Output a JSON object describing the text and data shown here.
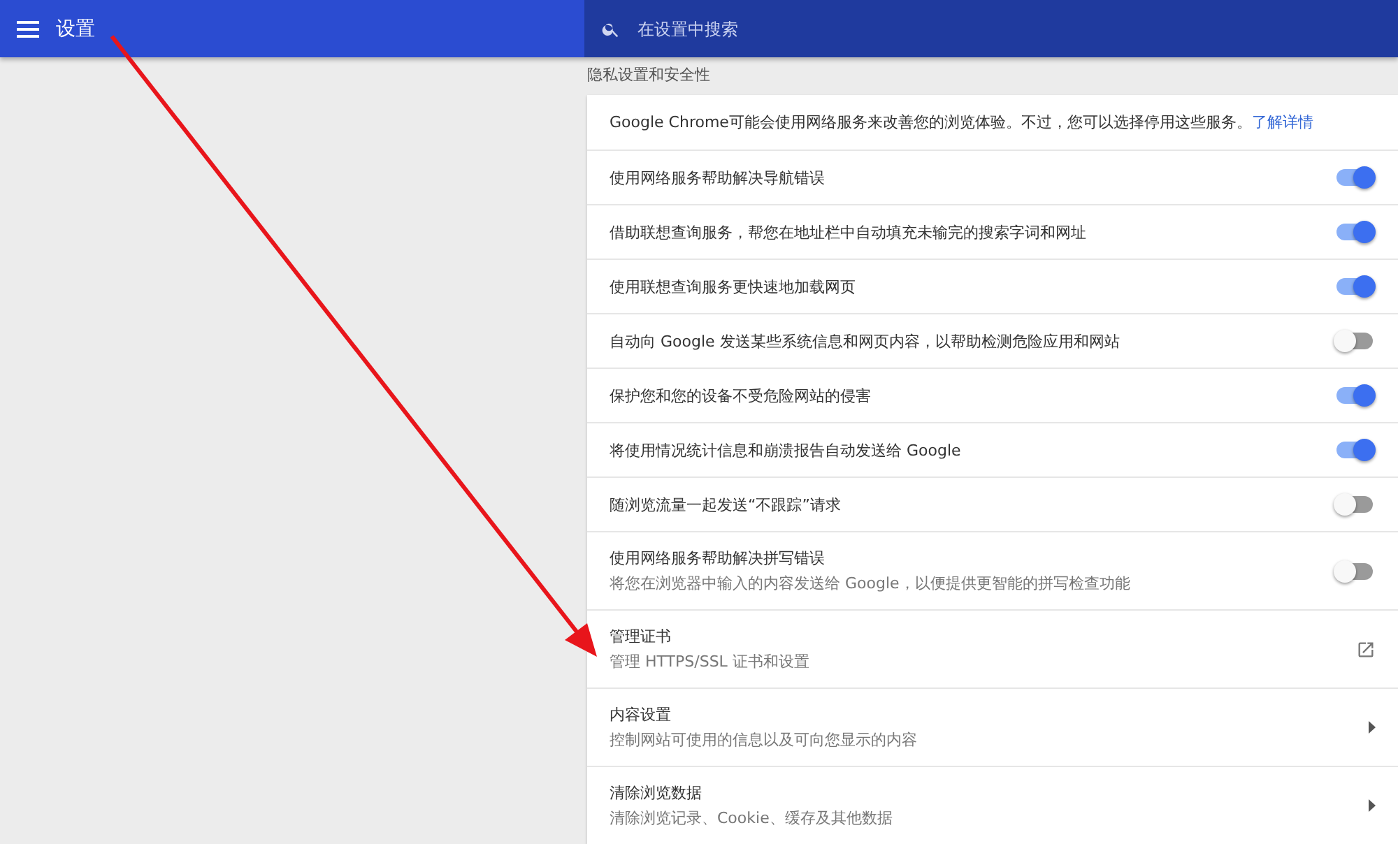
{
  "header": {
    "title": "设置",
    "search": {
      "placeholder": "在设置中搜索"
    }
  },
  "section": {
    "title": "隐私设置和安全性",
    "rows": [
      {
        "kind": "info",
        "text": "Google Chrome可能会使用网络服务来改善您的浏览体验。不过，您可以选择停用这些服务。",
        "link": "了解详情"
      },
      {
        "kind": "toggle",
        "label": "使用网络服务帮助解决导航错误",
        "on": true
      },
      {
        "kind": "toggle",
        "label": "借助联想查询服务，帮您在地址栏中自动填充未输完的搜索字词和网址",
        "on": true
      },
      {
        "kind": "toggle",
        "label": "使用联想查询服务更快速地加载网页",
        "on": true
      },
      {
        "kind": "toggle",
        "label": "自动向 Google 发送某些系统信息和网页内容，以帮助检测危险应用和网站",
        "on": false
      },
      {
        "kind": "toggle",
        "label": "保护您和您的设备不受危险网站的侵害",
        "on": true
      },
      {
        "kind": "toggle",
        "label": "将使用情况统计信息和崩溃报告自动发送给 Google",
        "on": true
      },
      {
        "kind": "toggle",
        "label": "随浏览流量一起发送“不跟踪”请求",
        "on": false
      },
      {
        "kind": "toggle",
        "label": "使用网络服务帮助解决拼写错误",
        "sublabel": "将您在浏览器中输入的内容发送给 Google，以便提供更智能的拼写检查功能",
        "on": false
      },
      {
        "kind": "external",
        "label": "管理证书",
        "sublabel": "管理 HTTPS/SSL 证书和设置"
      },
      {
        "kind": "submenu",
        "label": "内容设置",
        "sublabel": "控制网站可使用的信息以及可向您显示的内容"
      },
      {
        "kind": "submenu",
        "label": "清除浏览数据",
        "sublabel": "清除浏览记录、Cookie、缓存及其他数据"
      }
    ]
  }
}
